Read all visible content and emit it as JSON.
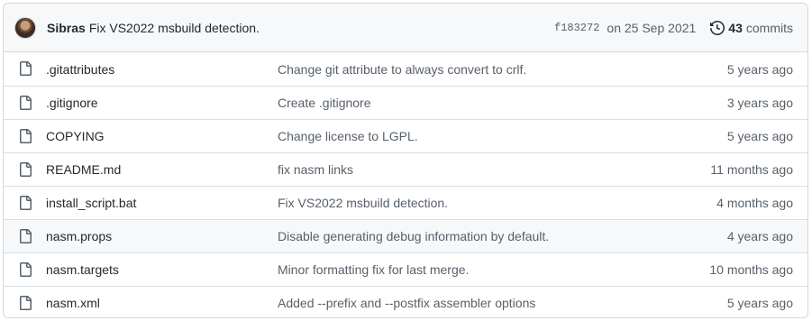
{
  "commit": {
    "author": "Sibras",
    "message": "Fix VS2022 msbuild detection.",
    "sha": "f183272",
    "date": "on 25 Sep 2021",
    "commits_count": "43",
    "commits_word": "commits"
  },
  "files": [
    {
      "name": ".gitattributes",
      "message": "Change git attribute to always convert to crlf.",
      "age": "5 years ago",
      "icon": "file-icon"
    },
    {
      "name": ".gitignore",
      "message": "Create .gitignore",
      "age": "3 years ago",
      "icon": "file-icon"
    },
    {
      "name": "COPYING",
      "message": "Change license to LGPL.",
      "age": "5 years ago",
      "icon": "file-icon"
    },
    {
      "name": "README.md",
      "message": "fix nasm links",
      "age": "11 months ago",
      "icon": "file-icon"
    },
    {
      "name": "install_script.bat",
      "message": "Fix VS2022 msbuild detection.",
      "age": "4 months ago",
      "icon": "file-icon"
    },
    {
      "name": "nasm.props",
      "message": "Disable generating debug information by default.",
      "age": "4 years ago",
      "icon": "file-icon"
    },
    {
      "name": "nasm.targets",
      "message": "Minor formatting fix for last merge.",
      "age": "10 months ago",
      "icon": "file-icon"
    },
    {
      "name": "nasm.xml",
      "message": "Added --prefix and --postfix assembler options",
      "age": "5 years ago",
      "icon": "file-icon"
    }
  ],
  "colors": {
    "border": "#d0d7de",
    "header_bg": "#f6f8fa",
    "muted_text": "#57606a",
    "text": "#24292f"
  }
}
